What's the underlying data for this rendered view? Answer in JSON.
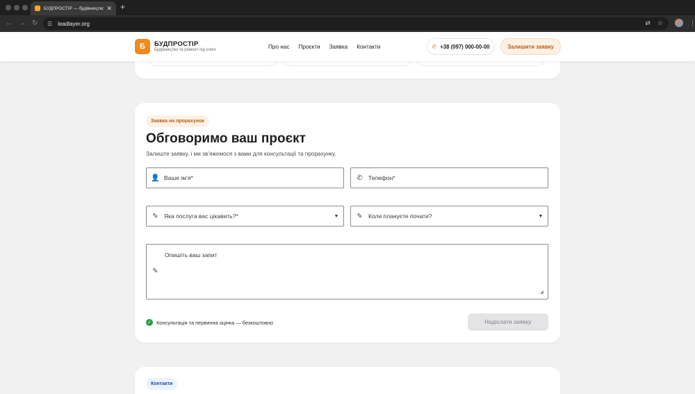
{
  "browser": {
    "tab_title": "БУДПРОСТІР — будівництво",
    "url": "leadlayer.org"
  },
  "header": {
    "logo_letter": "Б",
    "brand_name": "БУДПРОСТІР",
    "brand_tagline": "Будівництво та ремонт під ключ",
    "nav": [
      "Про нас",
      "Проєкти",
      "Заявка",
      "Контакти"
    ],
    "phone": "+38 (097) 000-00-00",
    "cta": "Залишити заявку"
  },
  "form": {
    "badge": "Заявка на прорахунок",
    "title": "Обговоримо ваш проєкт",
    "subtitle": "Залиште заявку, і ми зв’яжемося з вами для консультації та прорахунку.",
    "name_placeholder": "Ваше ім’я*",
    "phone_placeholder": "Телефон*",
    "service_placeholder": "Яка послуга вас цікавить?*",
    "when_placeholder": "Коли плануєте почати?",
    "message_placeholder": "Опишіть ваш запит",
    "note": "Консультація та первинна оцінка — безкоштовно",
    "submit": "Надіслати заявку"
  },
  "contacts": {
    "badge": "Контакти"
  },
  "colors": {
    "accent": "#f08a1c",
    "accent_text": "#b85d10",
    "success": "#25a244",
    "page_bg": "#f1f1f2"
  }
}
